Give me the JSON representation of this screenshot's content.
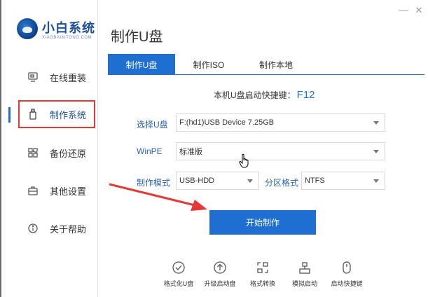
{
  "app": {
    "logo_title": "小白系统",
    "logo_subtitle": "XIAOBAIXITONG.COM"
  },
  "window_controls": {
    "minimize": "—",
    "close": "✕"
  },
  "sidebar": {
    "items": [
      {
        "label": "在线重装",
        "icon": "monitor-icon"
      },
      {
        "label": "制作系统",
        "icon": "usb-icon",
        "active": true
      },
      {
        "label": "备份还原",
        "icon": "grid-icon"
      },
      {
        "label": "其他设置",
        "icon": "briefcase-icon"
      },
      {
        "label": "关于帮助",
        "icon": "info-icon"
      }
    ]
  },
  "page": {
    "title": "制作U盘"
  },
  "tabs": [
    {
      "label": "制作U盘",
      "active": true
    },
    {
      "label": "制作ISO",
      "active": false
    },
    {
      "label": "制作本地",
      "active": false
    }
  ],
  "hotkey": {
    "label": "本机U盘启动快捷键：",
    "key": "F12"
  },
  "form": {
    "usb_label": "选择U盘",
    "usb_value": "F:(hd1)USB Device 7.25GB",
    "winpe_label": "WinPE",
    "winpe_value": "标准版",
    "mode_label": "制作模式",
    "mode_value": "USB-HDD",
    "partition_label": "分区格式",
    "partition_value": "NTFS"
  },
  "start_button": "开始制作",
  "tools": [
    {
      "label": "格式化U盘",
      "icon": "check-circle-icon"
    },
    {
      "label": "升级启动盘",
      "icon": "upload-circle-icon"
    },
    {
      "label": "格式转换",
      "icon": "convert-icon"
    },
    {
      "label": "模拟启动",
      "icon": "simulate-icon"
    },
    {
      "label": "启动快捷键",
      "icon": "mouse-icon"
    }
  ],
  "colors": {
    "accent": "#1e6fd1",
    "highlight_red": "#e53935",
    "label_blue": "#2a62b5"
  }
}
